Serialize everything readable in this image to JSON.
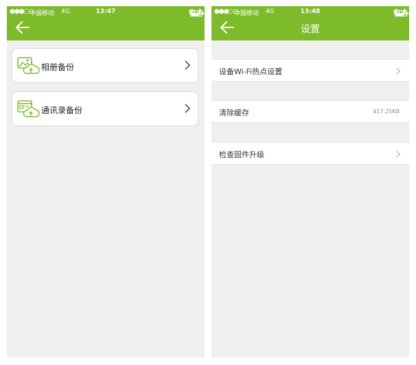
{
  "colors": {
    "accent": "#7dbb2a",
    "background": "#efefef"
  },
  "left_screen": {
    "status": {
      "signal": "●●●○○",
      "carrier": "中国移动",
      "network": "4G",
      "time": "13:47",
      "battery": "71%"
    },
    "items": [
      {
        "label": "相册备份",
        "icon": "photo-cloud-upload-icon"
      },
      {
        "label": "通讯录备份",
        "icon": "contacts-cloud-upload-icon"
      }
    ]
  },
  "right_screen": {
    "status": {
      "signal": "●●●○○",
      "carrier": "中国移动",
      "network": "4G",
      "time": "13:48",
      "battery": "71%"
    },
    "title": "设置",
    "rows": [
      {
        "label": "设备Wi-Fi热点设置",
        "value": ""
      },
      {
        "label": "清除缓存",
        "value": "417.25KB"
      },
      {
        "label": "检查固件升级",
        "value": ""
      }
    ]
  }
}
